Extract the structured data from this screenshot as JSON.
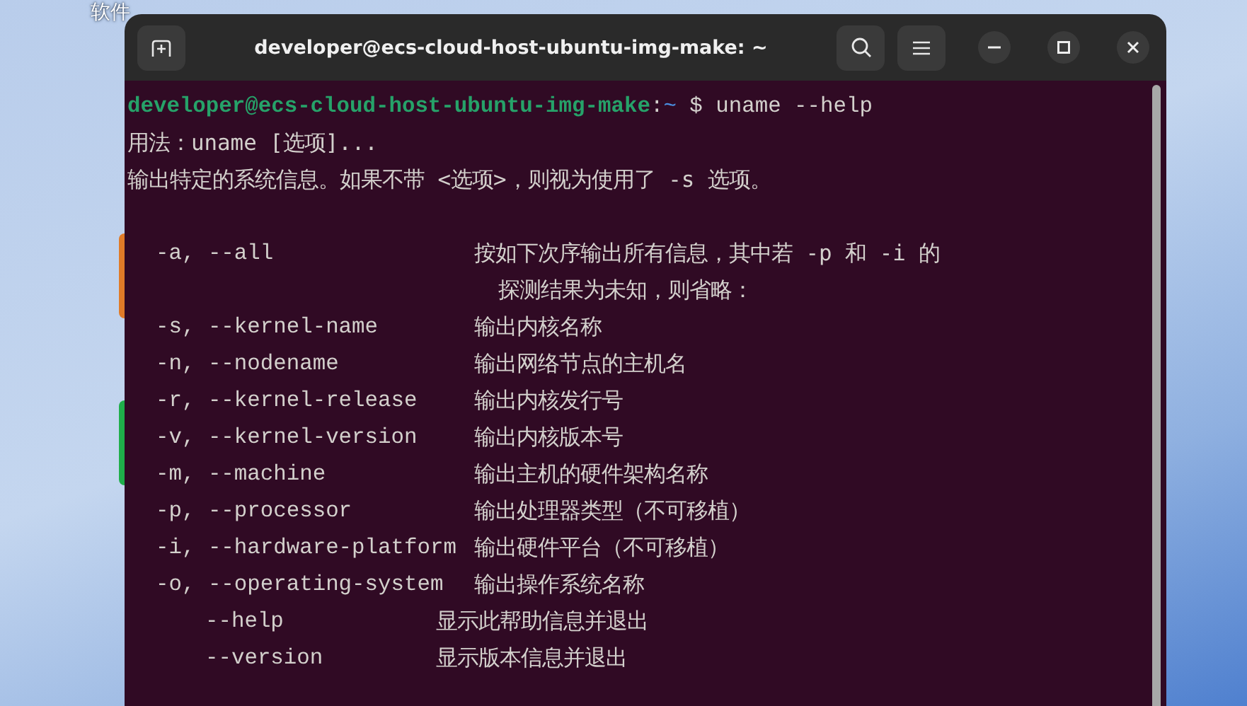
{
  "desktop": {
    "labels": [
      "软件"
    ],
    "icons": [
      {
        "color": "#e07b28"
      },
      {
        "color": "#1fae4a"
      }
    ]
  },
  "window": {
    "title": "developer@ecs-cloud-host-ubuntu-img-make: ~"
  },
  "terminal": {
    "lines": [
      {
        "kind": "prompt",
        "user_host": "developer@ecs-cloud-host-ubuntu-img-make",
        "separator": ":",
        "path": "~",
        "command": "$ uname --help"
      },
      {
        "kind": "text",
        "text": "用法：uname [选项]..."
      },
      {
        "kind": "text",
        "text": "输出特定的系统信息。如果不带 <选项>，则视为使用了 -s 选项。"
      },
      {
        "kind": "blank"
      },
      {
        "kind": "option",
        "flag": "-a, --all",
        "desc": "按如下次序输出所有信息，其中若 -p 和 -i 的"
      },
      {
        "kind": "continuation",
        "text": "探测结果为未知，则省略："
      },
      {
        "kind": "option",
        "flag": "-s, --kernel-name",
        "desc": "输出内核名称"
      },
      {
        "kind": "option",
        "flag": "-n, --nodename",
        "desc": "输出网络节点的主机名"
      },
      {
        "kind": "option",
        "flag": "-r, --kernel-release",
        "desc": "输出内核发行号"
      },
      {
        "kind": "option",
        "flag": "-v, --kernel-version",
        "desc": "输出内核版本号"
      },
      {
        "kind": "option",
        "flag": "-m, --machine",
        "desc": "输出主机的硬件架构名称"
      },
      {
        "kind": "option",
        "flag": "-p, --processor",
        "desc": "输出处理器类型（不可移植）"
      },
      {
        "kind": "option",
        "flag": "-i, --hardware-platform",
        "desc": "输出硬件平台（不可移植）"
      },
      {
        "kind": "option",
        "flag": "-o, --operating-system",
        "desc": "输出操作系统名称"
      },
      {
        "kind": "long_option",
        "flag": "--help",
        "desc": "显示此帮助信息并退出"
      },
      {
        "kind": "long_option",
        "flag": "--version",
        "desc": "显示版本信息并退出"
      }
    ]
  }
}
